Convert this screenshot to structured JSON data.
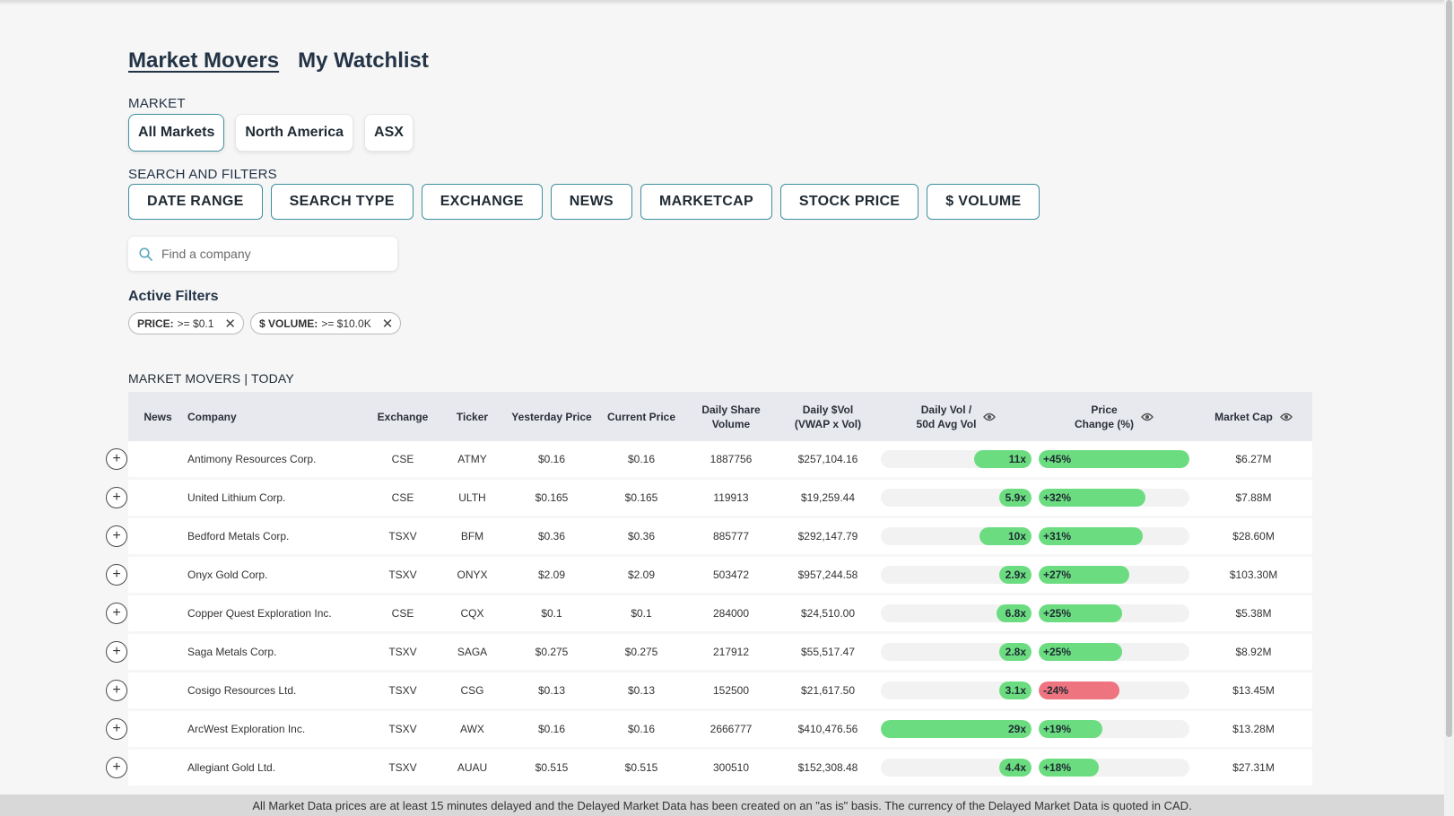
{
  "tabs": [
    {
      "label": "Market Movers",
      "active": true
    },
    {
      "label": "My Watchlist",
      "active": false
    }
  ],
  "market": {
    "label": "MARKET",
    "buttons": [
      {
        "label": "All Markets",
        "active": true
      },
      {
        "label": "North America",
        "active": false
      },
      {
        "label": "ASX",
        "active": false
      }
    ]
  },
  "filters": {
    "label": "SEARCH AND FILTERS",
    "buttons": [
      "DATE RANGE",
      "SEARCH TYPE",
      "EXCHANGE",
      "NEWS",
      "MARKETCAP",
      "STOCK PRICE",
      "$ VOLUME"
    ]
  },
  "search": {
    "placeholder": "Find a company",
    "value": "",
    "icon": "search-icon"
  },
  "active_filters": {
    "title": "Active Filters",
    "chips": [
      {
        "key": "PRICE:",
        "value": ">= $0.1"
      },
      {
        "key": "$ VOLUME:",
        "value": ">= $10.0K"
      }
    ]
  },
  "table": {
    "title_main": "MARKET MOVERS",
    "title_period": "TODAY",
    "columns": {
      "news": "News",
      "company": "Company",
      "exchange": "Exchange",
      "ticker": "Ticker",
      "yprice": "Yesterday Price",
      "cprice": "Current Price",
      "sharevol_1": "Daily Share",
      "sharevol_2": "Volume",
      "dvol_1": "Daily $Vol",
      "dvol_2": "(VWAP x Vol)",
      "ratio_1": "Daily Vol /",
      "ratio_2": "50d Avg Vol",
      "chg_1": "Price",
      "chg_2": "Change (%)",
      "mcap": "Market Cap"
    },
    "bar_colors": {
      "positive": "#6bdd80",
      "negative": "#ee7480"
    },
    "rows": [
      {
        "company": "Antimony Resources Corp.",
        "exchange": "CSE",
        "ticker": "ATMY",
        "yprice": "$0.16",
        "cprice": "$0.16",
        "sharevol": "1887756",
        "dvol": "$257,104.16",
        "ratio": 11,
        "ratio_label": "11x",
        "change": 45,
        "change_label": "+45%",
        "mcap": "$6.27M"
      },
      {
        "company": "United Lithium Corp.",
        "exchange": "CSE",
        "ticker": "ULTH",
        "yprice": "$0.165",
        "cprice": "$0.165",
        "sharevol": "119913",
        "dvol": "$19,259.44",
        "ratio": 5.9,
        "ratio_label": "5.9x",
        "change": 32,
        "change_label": "+32%",
        "mcap": "$7.88M"
      },
      {
        "company": "Bedford Metals Corp.",
        "exchange": "TSXV",
        "ticker": "BFM",
        "yprice": "$0.36",
        "cprice": "$0.36",
        "sharevol": "885777",
        "dvol": "$292,147.79",
        "ratio": 10,
        "ratio_label": "10x",
        "change": 31,
        "change_label": "+31%",
        "mcap": "$28.60M"
      },
      {
        "company": "Onyx Gold Corp.",
        "exchange": "TSXV",
        "ticker": "ONYX",
        "yprice": "$2.09",
        "cprice": "$2.09",
        "sharevol": "503472",
        "dvol": "$957,244.58",
        "ratio": 2.9,
        "ratio_label": "2.9x",
        "change": 27,
        "change_label": "+27%",
        "mcap": "$103.30M"
      },
      {
        "company": "Copper Quest Exploration Inc.",
        "exchange": "CSE",
        "ticker": "CQX",
        "yprice": "$0.1",
        "cprice": "$0.1",
        "sharevol": "284000",
        "dvol": "$24,510.00",
        "ratio": 6.8,
        "ratio_label": "6.8x",
        "change": 25,
        "change_label": "+25%",
        "mcap": "$5.38M"
      },
      {
        "company": "Saga Metals Corp.",
        "exchange": "TSXV",
        "ticker": "SAGA",
        "yprice": "$0.275",
        "cprice": "$0.275",
        "sharevol": "217912",
        "dvol": "$55,517.47",
        "ratio": 2.8,
        "ratio_label": "2.8x",
        "change": 25,
        "change_label": "+25%",
        "mcap": "$8.92M"
      },
      {
        "company": "Cosigo Resources Ltd.",
        "exchange": "TSXV",
        "ticker": "CSG",
        "yprice": "$0.13",
        "cprice": "$0.13",
        "sharevol": "152500",
        "dvol": "$21,617.50",
        "ratio": 3.1,
        "ratio_label": "3.1x",
        "change": -24,
        "change_label": "-24%",
        "mcap": "$13.45M"
      },
      {
        "company": "ArcWest Exploration Inc.",
        "exchange": "TSXV",
        "ticker": "AWX",
        "yprice": "$0.16",
        "cprice": "$0.16",
        "sharevol": "2666777",
        "dvol": "$410,476.56",
        "ratio": 29,
        "ratio_label": "29x",
        "change": 19,
        "change_label": "+19%",
        "mcap": "$13.28M"
      },
      {
        "company": "Allegiant Gold Ltd.",
        "exchange": "TSXV",
        "ticker": "AUAU",
        "yprice": "$0.515",
        "cprice": "$0.515",
        "sharevol": "300510",
        "dvol": "$152,308.48",
        "ratio": 4.4,
        "ratio_label": "4.4x",
        "change": 18,
        "change_label": "+18%",
        "mcap": "$27.31M"
      }
    ]
  },
  "footer": {
    "text": "All Market Data prices are at least 15 minutes delayed and the Delayed Market Data has been created on an \"as is\" basis. The currency of the Delayed Market Data is quoted in CAD."
  }
}
